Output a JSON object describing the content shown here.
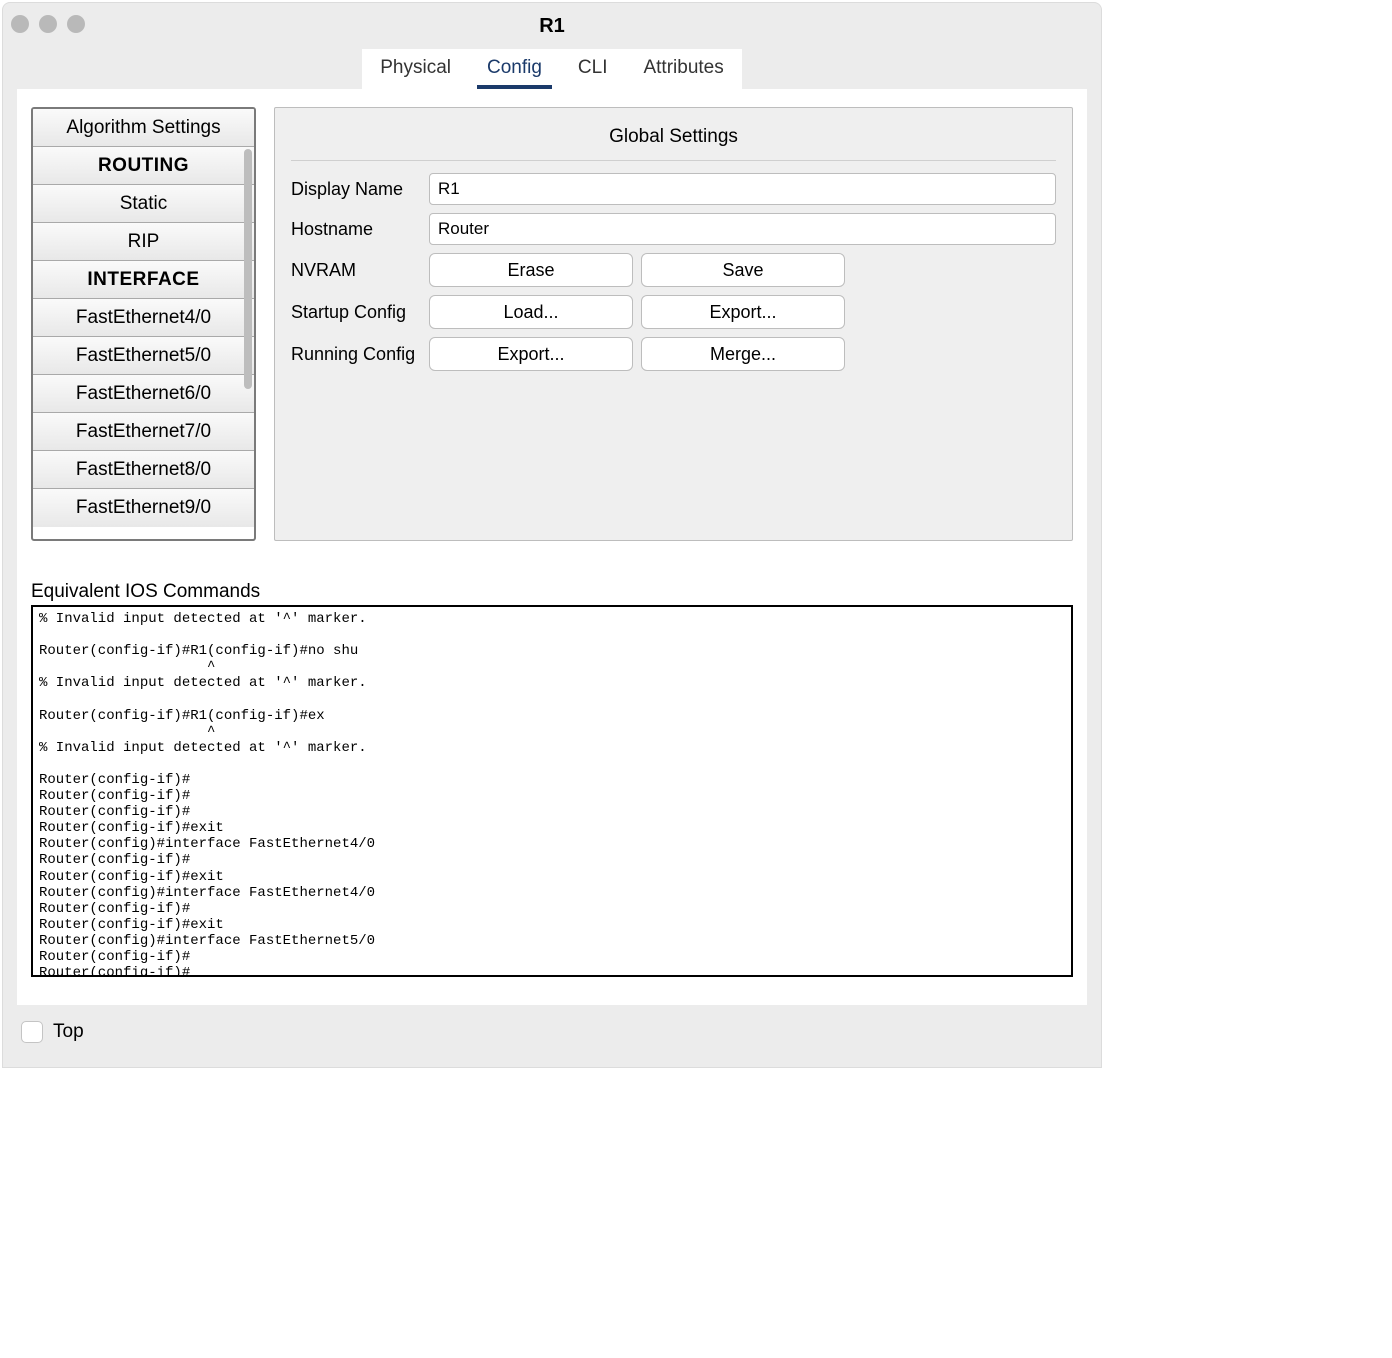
{
  "window": {
    "title": "R1"
  },
  "tabs": {
    "physical": "Physical",
    "config": "Config",
    "cli": "CLI",
    "attributes": "Attributes"
  },
  "sidebar": {
    "algorithm": "Algorithm Settings",
    "routing_header": "ROUTING",
    "static": "Static",
    "rip": "RIP",
    "interface_header": "INTERFACE",
    "fe40": "FastEthernet4/0",
    "fe50": "FastEthernet5/0",
    "fe60": "FastEthernet6/0",
    "fe70": "FastEthernet7/0",
    "fe80": "FastEthernet8/0",
    "fe90": "FastEthernet9/0"
  },
  "panel": {
    "title": "Global Settings",
    "display_name_label": "Display Name",
    "display_name_value": "R1",
    "hostname_label": "Hostname",
    "hostname_value": "Router",
    "nvram_label": "NVRAM",
    "nvram_erase": "Erase",
    "nvram_save": "Save",
    "startup_label": "Startup Config",
    "startup_load": "Load...",
    "startup_export": "Export...",
    "running_label": "Running Config",
    "running_export": "Export...",
    "running_merge": "Merge..."
  },
  "ios": {
    "label": "Equivalent IOS Commands",
    "text": "% Invalid input detected at '^' marker.\n\nRouter(config-if)#R1(config-if)#no shu\n                    ^\n% Invalid input detected at '^' marker.\n\nRouter(config-if)#R1(config-if)#ex\n                    ^\n% Invalid input detected at '^' marker.\n\nRouter(config-if)#\nRouter(config-if)#\nRouter(config-if)#\nRouter(config-if)#exit\nRouter(config)#interface FastEthernet4/0\nRouter(config-if)#\nRouter(config-if)#exit\nRouter(config)#interface FastEthernet4/0\nRouter(config-if)#\nRouter(config-if)#exit\nRouter(config)#interface FastEthernet5/0\nRouter(config-if)#\nRouter(config-if)#"
  },
  "footer": {
    "top": "Top"
  }
}
